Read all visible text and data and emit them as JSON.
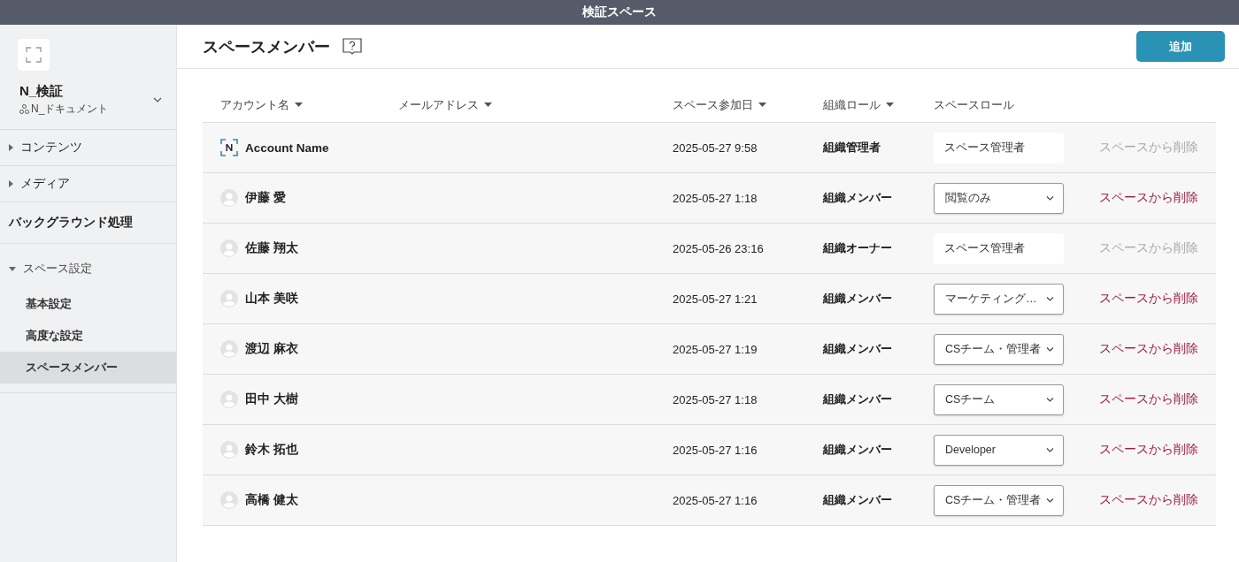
{
  "window": {
    "title": "検証スペース"
  },
  "sidebar": {
    "space_name": "N_検証",
    "org_name": "N_ドキュメント",
    "items": [
      {
        "kind": "group",
        "label": "コンテンツ",
        "expanded": false
      },
      {
        "kind": "group",
        "label": "メディア",
        "expanded": false
      },
      {
        "kind": "link",
        "label": "バックグラウンド処理"
      },
      {
        "kind": "group",
        "label": "スペース設定",
        "expanded": true,
        "children": [
          {
            "label": "基本設定",
            "selected": false
          },
          {
            "label": "高度な設定",
            "selected": false
          },
          {
            "label": "スペースメンバー",
            "selected": true
          }
        ]
      }
    ]
  },
  "header": {
    "title": "スペースメンバー",
    "add_button": "追加"
  },
  "table": {
    "columns": [
      {
        "label": "アカウント名",
        "sortable": true
      },
      {
        "label": "メールアドレス",
        "sortable": true
      },
      {
        "label": "スペース参加日",
        "sortable": true
      },
      {
        "label": "組織ロール",
        "sortable": true
      },
      {
        "label": "スペースロール",
        "sortable": false
      }
    ],
    "rows": [
      {
        "kind": "account",
        "name": "Account Name",
        "joined": "2025-05-27 9:58",
        "org_role": "組織管理者",
        "space_role": "スペース管理者",
        "role_editable": false,
        "remove": "スペースから削除",
        "remove_disabled": true
      },
      {
        "kind": "person",
        "name": "伊藤 愛",
        "joined": "2025-05-27 1:18",
        "org_role": "組織メンバー",
        "space_role": "閲覧のみ",
        "role_editable": true,
        "remove": "スペースから削除",
        "remove_disabled": false
      },
      {
        "kind": "person",
        "name": "佐藤 翔太",
        "joined": "2025-05-26 23:16",
        "org_role": "組織オーナー",
        "space_role": "スペース管理者",
        "role_editable": false,
        "remove": "スペースから削除",
        "remove_disabled": true
      },
      {
        "kind": "person",
        "name": "山本 美咲",
        "joined": "2025-05-27 1:21",
        "org_role": "組織メンバー",
        "space_role": "マーケティング…",
        "role_editable": true,
        "remove": "スペースから削除",
        "remove_disabled": false
      },
      {
        "kind": "person",
        "name": "渡辺 麻衣",
        "joined": "2025-05-27 1:19",
        "org_role": "組織メンバー",
        "space_role": "CSチーム・管理者",
        "role_editable": true,
        "remove": "スペースから削除",
        "remove_disabled": false
      },
      {
        "kind": "person",
        "name": "田中 大樹",
        "joined": "2025-05-27 1:18",
        "org_role": "組織メンバー",
        "space_role": "CSチーム",
        "role_editable": true,
        "remove": "スペースから削除",
        "remove_disabled": false
      },
      {
        "kind": "person",
        "name": "鈴木 拓也",
        "joined": "2025-05-27 1:16",
        "org_role": "組織メンバー",
        "space_role": "Developer",
        "role_editable": true,
        "remove": "スペースから削除",
        "remove_disabled": false
      },
      {
        "kind": "person",
        "name": "高橋 健太",
        "joined": "2025-05-27 1:16",
        "org_role": "組織メンバー",
        "space_role": "CSチーム・管理者",
        "role_editable": true,
        "remove": "スペースから削除",
        "remove_disabled": false
      }
    ]
  }
}
